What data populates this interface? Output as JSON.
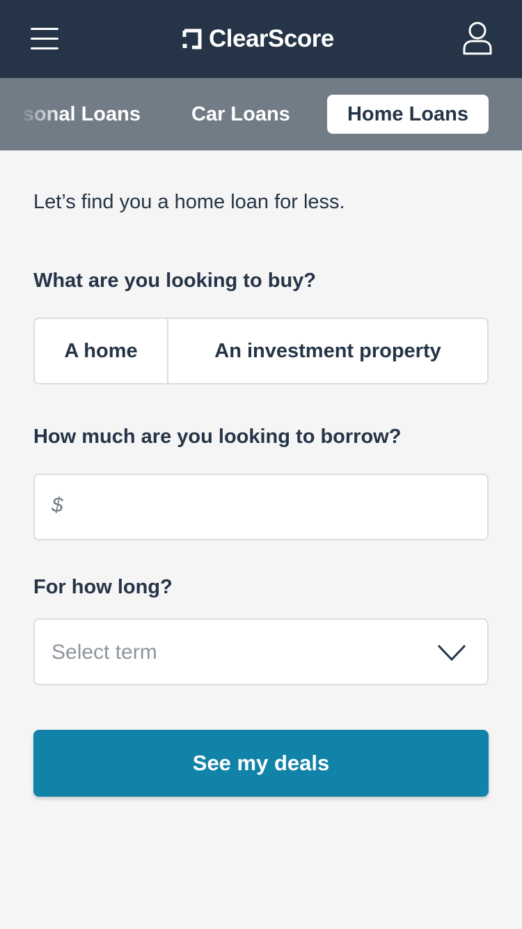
{
  "header": {
    "brand_name": "ClearScore",
    "menu_icon": "hamburger-menu-icon",
    "profile_icon": "user-profile-icon",
    "background_color": "#253447"
  },
  "tabs": [
    {
      "label": "Personal Loans",
      "visible_label": "sonal Loans",
      "active": false
    },
    {
      "label": "Car Loans",
      "visible_label": "Car Loans",
      "active": false
    },
    {
      "label": "Home Loans",
      "visible_label": "Home Loans",
      "active": true
    }
  ],
  "form": {
    "intro": "Let’s find you a home loan for less.",
    "purpose": {
      "question": "What are you looking to buy?",
      "options": [
        "A home",
        "An investment property"
      ]
    },
    "amount": {
      "question": "How much are you looking to borrow?",
      "currency_symbol": "$",
      "value": ""
    },
    "term": {
      "question": "For how long?",
      "placeholder": "Select term",
      "icon": "chevron-down-icon"
    },
    "submit_label": "See my deals"
  },
  "colors": {
    "navy": "#253447",
    "tab_bar": "#727c87",
    "cta": "#1283a8",
    "border": "#dadde1",
    "background": "#f5f5f5"
  }
}
